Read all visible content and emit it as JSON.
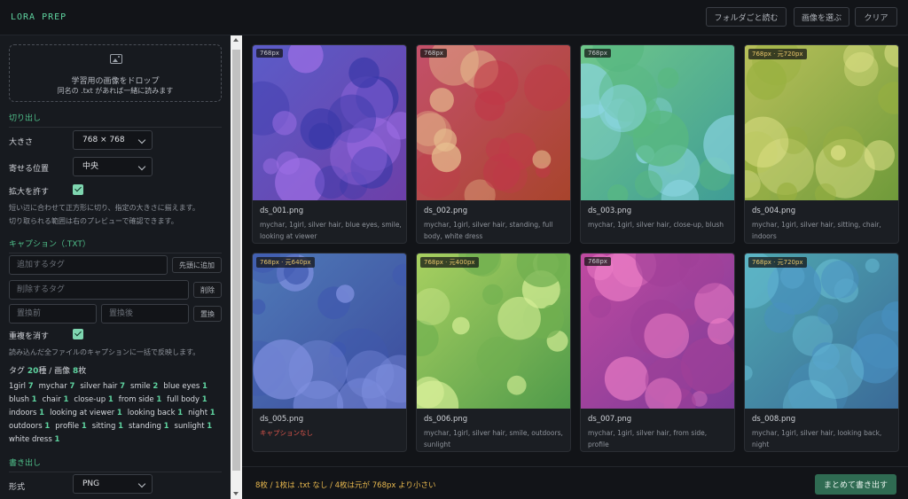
{
  "app": {
    "logo": "LORA PREP"
  },
  "header": {
    "folder_btn": "フォルダごと読む",
    "select_btn": "画像を選ぶ",
    "clear_btn": "クリア"
  },
  "sidebar": {
    "dropzone": {
      "main": "学習用の画像をドロップ",
      "sub": "同名の .txt があれば一緒に読みます"
    },
    "crop": {
      "title": "切り出し",
      "size_label": "大きさ",
      "size_value": "768 × 768",
      "position_label": "寄せる位置",
      "position_value": "中央",
      "upscale_label": "拡大を許す",
      "note1": "短い辺に合わせて正方形に切り、指定の大きさに揃えます。",
      "note2": "切り取られる範囲は右のプレビューで確認できます。"
    },
    "caption": {
      "title": "キャプション（.TXT）",
      "add_placeholder": "追加するタグ",
      "add_btn": "先頭に追加",
      "remove_placeholder": "削除するタグ",
      "remove_btn": "削除",
      "replace_from_placeholder": "置換前",
      "replace_to_placeholder": "置換後",
      "replace_btn": "置換",
      "dedupe_label": "重複を消す",
      "note": "読み込んだ全ファイルのキャプションに一括で反映します。",
      "tag_summary": {
        "prefix": "タグ ",
        "count": "20",
        "mid": "種 / 画像 ",
        "images": "8",
        "suffix": "枚"
      },
      "tags": [
        {
          "name": "1girl",
          "count": "7"
        },
        {
          "name": "mychar",
          "count": "7"
        },
        {
          "name": "silver hair",
          "count": "7"
        },
        {
          "name": "smile",
          "count": "2"
        },
        {
          "name": "blue eyes",
          "count": "1"
        },
        {
          "name": "blush",
          "count": "1"
        },
        {
          "name": "chair",
          "count": "1"
        },
        {
          "name": "close-up",
          "count": "1"
        },
        {
          "name": "from side",
          "count": "1"
        },
        {
          "name": "full body",
          "count": "1"
        },
        {
          "name": "indoors",
          "count": "1"
        },
        {
          "name": "looking at viewer",
          "count": "1"
        },
        {
          "name": "looking back",
          "count": "1"
        },
        {
          "name": "night",
          "count": "1"
        },
        {
          "name": "outdoors",
          "count": "1"
        },
        {
          "name": "profile",
          "count": "1"
        },
        {
          "name": "sitting",
          "count": "1"
        },
        {
          "name": "standing",
          "count": "1"
        },
        {
          "name": "sunlight",
          "count": "1"
        },
        {
          "name": "white dress",
          "count": "1"
        }
      ]
    },
    "export": {
      "title": "書き出し",
      "format_label": "形式",
      "format_value": "PNG"
    }
  },
  "cards": [
    {
      "badge": "768px",
      "warn": false,
      "name": "ds_001.png",
      "caption": "mychar, 1girl, silver hair, blue eyes, smile, looking at viewer",
      "error": false,
      "c1": "#5b5cc8",
      "c2": "#6d3fa8",
      "b1": "#a070e8",
      "b2": "#3838a8"
    },
    {
      "badge": "768px",
      "warn": false,
      "name": "ds_002.png",
      "caption": "mychar, 1girl, silver hair, standing, full body, white dress",
      "error": false,
      "c1": "#c4506a",
      "c2": "#a8442c",
      "b1": "#e8c090",
      "b2": "#c03848"
    },
    {
      "badge": "768px",
      "warn": false,
      "name": "ds_003.png",
      "caption": "mychar, 1girl, silver hair, close-up, blush",
      "error": false,
      "c1": "#6fc78a",
      "c2": "#3f9c96",
      "b1": "#8fd8e8",
      "b2": "#58b880"
    },
    {
      "badge": "768px · 元720px",
      "warn": true,
      "name": "ds_004.png",
      "caption": "mychar, 1girl, silver hair, sitting, chair, indoors",
      "error": false,
      "c1": "#b8c05a",
      "c2": "#6f9a3a",
      "b1": "#e8e890",
      "b2": "#98b040"
    },
    {
      "badge": "768px · 元640px",
      "warn": true,
      "name": "ds_005.png",
      "caption": "キャプションなし",
      "error": true,
      "c1": "#4f7ab8",
      "c2": "#3b4a9c",
      "b1": "#8090e0",
      "b2": "#3f58b0"
    },
    {
      "badge": "768px · 元400px",
      "warn": true,
      "name": "ds_006.png",
      "caption": "mychar, 1girl, silver hair, smile, outdoors, sunlight",
      "error": false,
      "c1": "#a8d060",
      "c2": "#4f9a4a",
      "b1": "#d8f098",
      "b2": "#70b050"
    },
    {
      "badge": "768px",
      "warn": false,
      "name": "ds_007.png",
      "caption": "mychar, 1girl, silver hair, from side, profile",
      "error": false,
      "c1": "#c04aa0",
      "c2": "#7a3a98",
      "b1": "#f080c8",
      "b2": "#a04098"
    },
    {
      "badge": "768px · 元720px",
      "warn": true,
      "name": "ds_008.png",
      "caption": "mychar, 1girl, silver hair, looking back, night",
      "error": false,
      "c1": "#4fa8b0",
      "c2": "#3a6a98",
      "b1": "#70c8e0",
      "b2": "#4890c0"
    }
  ],
  "footer": {
    "status": "8枚 / 1枚は .txt なし / 4枚は元が 768px より小さい",
    "export_btn": "まとめて書き出す"
  }
}
